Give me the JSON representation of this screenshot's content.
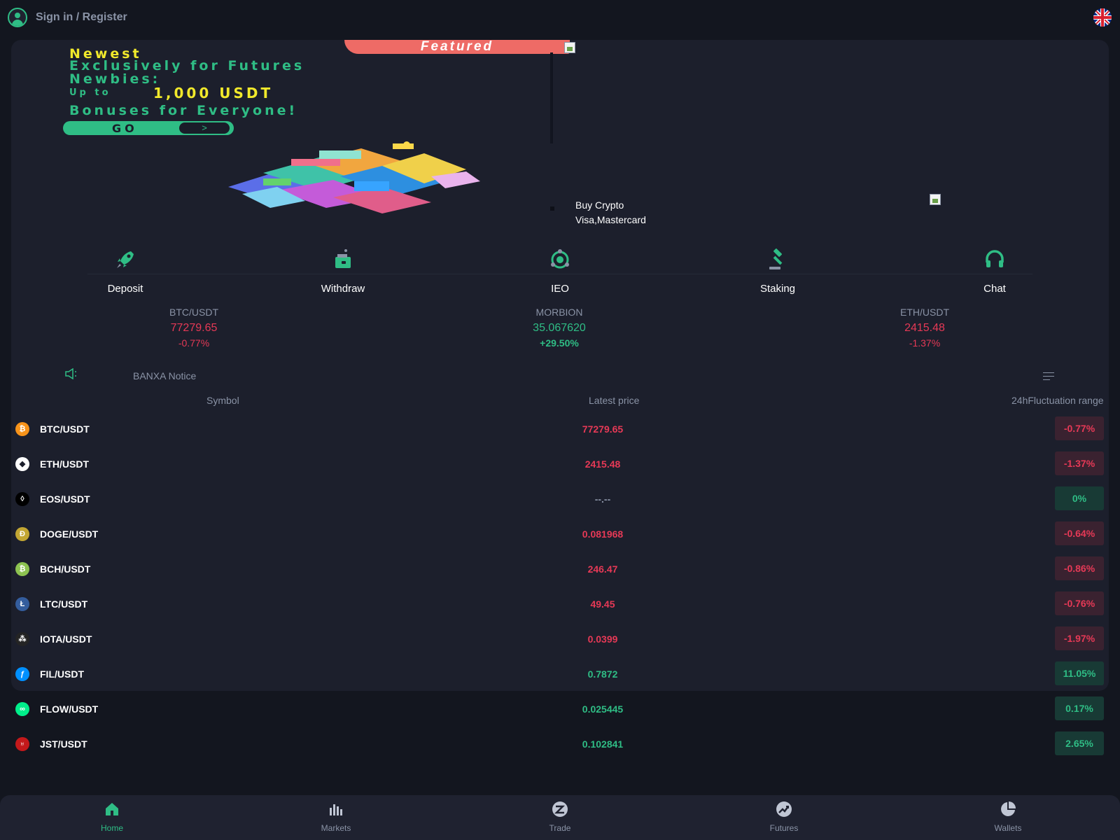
{
  "header": {
    "signin_label": "Sign in / Register",
    "language_flag": "uk-flag-icon"
  },
  "banner": {
    "featured": "Featured",
    "line1": "Newest",
    "line2": "Exclusively for Futures",
    "line3": "Newbies:",
    "upto": "Up to",
    "amount": "1,000 USDT",
    "bonus": "Bonuses for Everyone!",
    "go": "GO",
    "go_arrow": ">"
  },
  "buy_crypto": {
    "line1": "Buy Crypto",
    "line2": "Visa,Mastercard"
  },
  "actions": [
    {
      "label": "Deposit",
      "icon": "rocket-icon"
    },
    {
      "label": "Withdraw",
      "icon": "wallet-icon"
    },
    {
      "label": "IEO",
      "icon": "orbit-icon"
    },
    {
      "label": "Staking",
      "icon": "gavel-icon"
    },
    {
      "label": "Chat",
      "icon": "headset-icon"
    }
  ],
  "tickers": [
    {
      "symbol": "BTC/USDT",
      "price": "77279.65",
      "change": "-0.77%"
    },
    {
      "symbol": "MORBION",
      "price": "35.067620",
      "change": "+29.50%"
    },
    {
      "symbol": "ETH/USDT",
      "price": "2415.48",
      "change": "-1.37%"
    }
  ],
  "notice": {
    "text": "BANXA Notice"
  },
  "table": {
    "headers": {
      "symbol": "Symbol",
      "price": "Latest price",
      "range": "24hFluctuation range"
    },
    "rows": [
      {
        "pair": "BTC/USDT",
        "price": "77279.65",
        "change": "-0.77%",
        "trend": "down",
        "coin_color": "#f7931a",
        "coin_glyph": "₿"
      },
      {
        "pair": "ETH/USDT",
        "price": "2415.48",
        "change": "-1.37%",
        "trend": "down",
        "coin_color": "#ffffff",
        "coin_glyph": "◆"
      },
      {
        "pair": "EOS/USDT",
        "price": "--.--",
        "change": "0%",
        "trend": "flat",
        "coin_color": "#000000",
        "coin_glyph": "◊"
      },
      {
        "pair": "DOGE/USDT",
        "price": "0.081968",
        "change": "-0.64%",
        "trend": "down",
        "coin_color": "#c2a633",
        "coin_glyph": "Ð"
      },
      {
        "pair": "BCH/USDT",
        "price": "246.47",
        "change": "-0.86%",
        "trend": "down",
        "coin_color": "#8dc351",
        "coin_glyph": "₿"
      },
      {
        "pair": "LTC/USDT",
        "price": "49.45",
        "change": "-0.76%",
        "trend": "down",
        "coin_color": "#345d9d",
        "coin_glyph": "Ł"
      },
      {
        "pair": "IOTA/USDT",
        "price": "0.0399",
        "change": "-1.97%",
        "trend": "down",
        "coin_color": "#242424",
        "coin_glyph": "⁂"
      },
      {
        "pair": "FIL/USDT",
        "price": "0.7872",
        "change": "11.05%",
        "trend": "up",
        "coin_color": "#0090ff",
        "coin_glyph": "ƒ"
      },
      {
        "pair": "FLOW/USDT",
        "price": "0.025445",
        "change": "0.17%",
        "trend": "up",
        "coin_color": "#00ef8b",
        "coin_glyph": "∞"
      },
      {
        "pair": "JST/USDT",
        "price": "0.102841",
        "change": "2.65%",
        "trend": "up",
        "coin_color": "#c4191b",
        "coin_glyph": "♅"
      }
    ]
  },
  "bottom_nav": [
    {
      "label": "Home",
      "icon": "home-icon",
      "active": true
    },
    {
      "label": "Markets",
      "icon": "bar-chart-icon",
      "active": false
    },
    {
      "label": "Trade",
      "icon": "trade-icon",
      "active": false
    },
    {
      "label": "Futures",
      "icon": "futures-icon",
      "active": false
    },
    {
      "label": "Wallets",
      "icon": "pie-chart-icon",
      "active": false
    }
  ],
  "colors": {
    "background": "#13161f",
    "card": "#1c1f2c",
    "accent": "#2fbd85",
    "down": "#e63956",
    "muted": "#8a93a6",
    "banner_yellow": "#f1e92b",
    "featured": "#ee6b66"
  }
}
